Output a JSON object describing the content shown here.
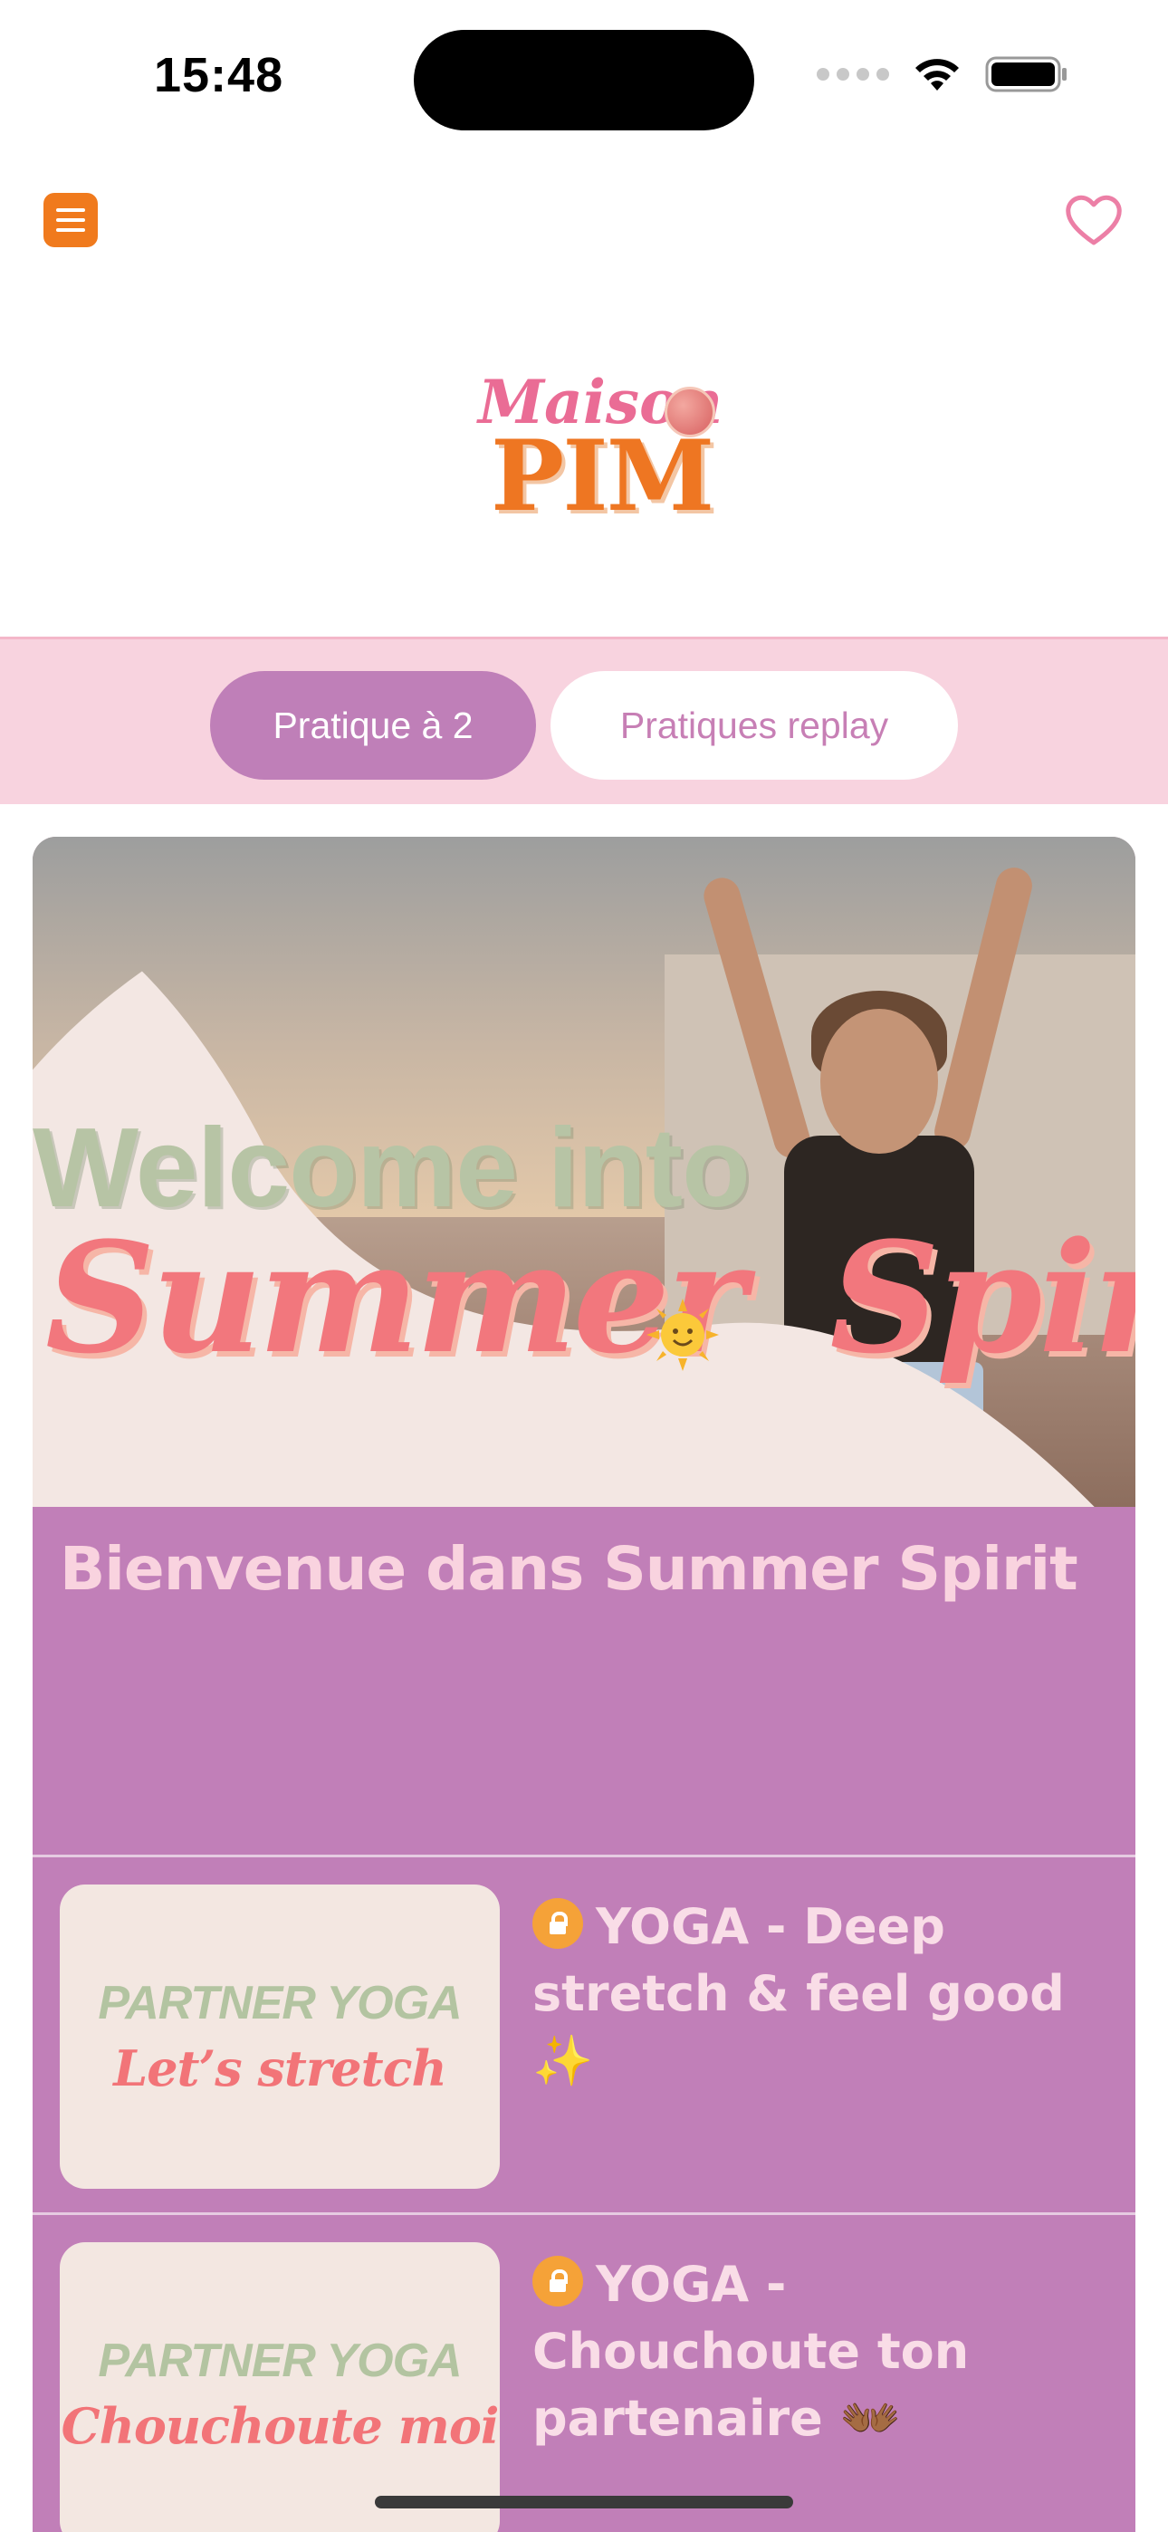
{
  "status_bar": {
    "time": "15:48"
  },
  "header": {
    "menu_icon": "hamburger-menu-icon",
    "favorite_icon": "heart-outline-icon",
    "logo_script": "Maison",
    "logo_main": "PIM"
  },
  "tabs": [
    {
      "label": "Pratique à 2",
      "active": true
    },
    {
      "label": "Pratiques replay",
      "active": false
    }
  ],
  "hero": {
    "line1": "Welcome into",
    "line2_a": "Summer",
    "line2_b": "Spirit",
    "title": "Bienvenue dans Summer Spirit"
  },
  "items": [
    {
      "thumb_top": "PARTNER YOGA",
      "thumb_bottom": "Let’s stretch",
      "title": "YOGA - Deep stretch & feel good ✨",
      "locked": true
    },
    {
      "thumb_top": "PARTNER YOGA",
      "thumb_bottom": "Chouchoute moi",
      "title": "YOGA - Chouchoute ton partenaire 👐🏾",
      "locked": true
    }
  ],
  "colors": {
    "accent_orange": "#f07a1d",
    "pink_bar": "#f8d3df",
    "tab_active": "#bf7fb8",
    "card_bg": "#c17fb8",
    "heart": "#ec7fa6"
  }
}
